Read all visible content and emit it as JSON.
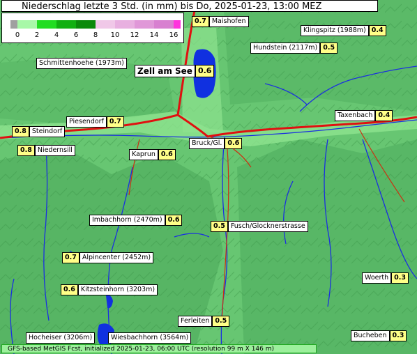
{
  "title": "Niederschlag letzte 3 Std. (in mm) bis Do, 2025-01-23, 13:00 MEZ",
  "legend": {
    "ticks": [
      "0",
      "2",
      "4",
      "6",
      "8",
      "10",
      "12",
      "14",
      "16"
    ],
    "colors": {
      "below_zero": "#a0a0a0",
      "0_2": "#a8f8a8",
      "2_4": "#22dd22",
      "4_6": "#11b011",
      "6_8": "#0a8a0a",
      "8_10": "#f0c8e8",
      "10_12": "#e8b0e0",
      "12_14": "#e098d8",
      "14_16": "#d880d0",
      "above_16": "#ff33dd"
    }
  },
  "places": [
    {
      "id": "maishofen",
      "name": "Maishofen",
      "value": "0.7"
    },
    {
      "id": "klingspitz",
      "name": "Klingspitz (1988m)",
      "value": "0.4"
    },
    {
      "id": "hundstein",
      "name": "Hundstein (2117m)",
      "value": "0.5"
    },
    {
      "id": "schmittenhoehe",
      "name": "Schmittenhoehe (1973m)",
      "value": ""
    },
    {
      "id": "zell-am-see",
      "name": "Zell am See",
      "value": "0.6"
    },
    {
      "id": "taxenbach",
      "name": "Taxenbach",
      "value": "0.4"
    },
    {
      "id": "piesendorf",
      "name": "Piesendorf",
      "value": "0.7"
    },
    {
      "id": "steindorf",
      "name": "Steindorf",
      "value": "0.8"
    },
    {
      "id": "niedernsill",
      "name": "Niedernsill",
      "value": "0.8"
    },
    {
      "id": "bruck",
      "name": "Bruck/Gl.",
      "value": "0.6"
    },
    {
      "id": "kaprun",
      "name": "Kaprun",
      "value": "0.6"
    },
    {
      "id": "imbachhorn",
      "name": "Imbachhorn (2470m)",
      "value": "0.6"
    },
    {
      "id": "fusch",
      "name": "Fusch/Glocknerstrasse",
      "value": "0.5"
    },
    {
      "id": "alpincenter",
      "name": "Alpincenter (2452m)",
      "value": "0.7"
    },
    {
      "id": "kitzsteinhorn",
      "name": "Kitzsteinhorn (3203m)",
      "value": "0.6"
    },
    {
      "id": "woerth",
      "name": "Woerth",
      "value": "0.3"
    },
    {
      "id": "ferleiten",
      "name": "Ferleiten",
      "value": "0.5"
    },
    {
      "id": "hocheiser",
      "name": "Hocheiser (3206m)",
      "value": ""
    },
    {
      "id": "wiesbachhorn",
      "name": "Wiesbachhorn (3564m)",
      "value": ""
    },
    {
      "id": "bucheben",
      "name": "Bucheben",
      "value": "0.3"
    }
  ],
  "footer": "GFS-based MetGIS Fcst, initialized 2025-01-23, 06:00 UTC  (resolution 99 m X 146 m)"
}
